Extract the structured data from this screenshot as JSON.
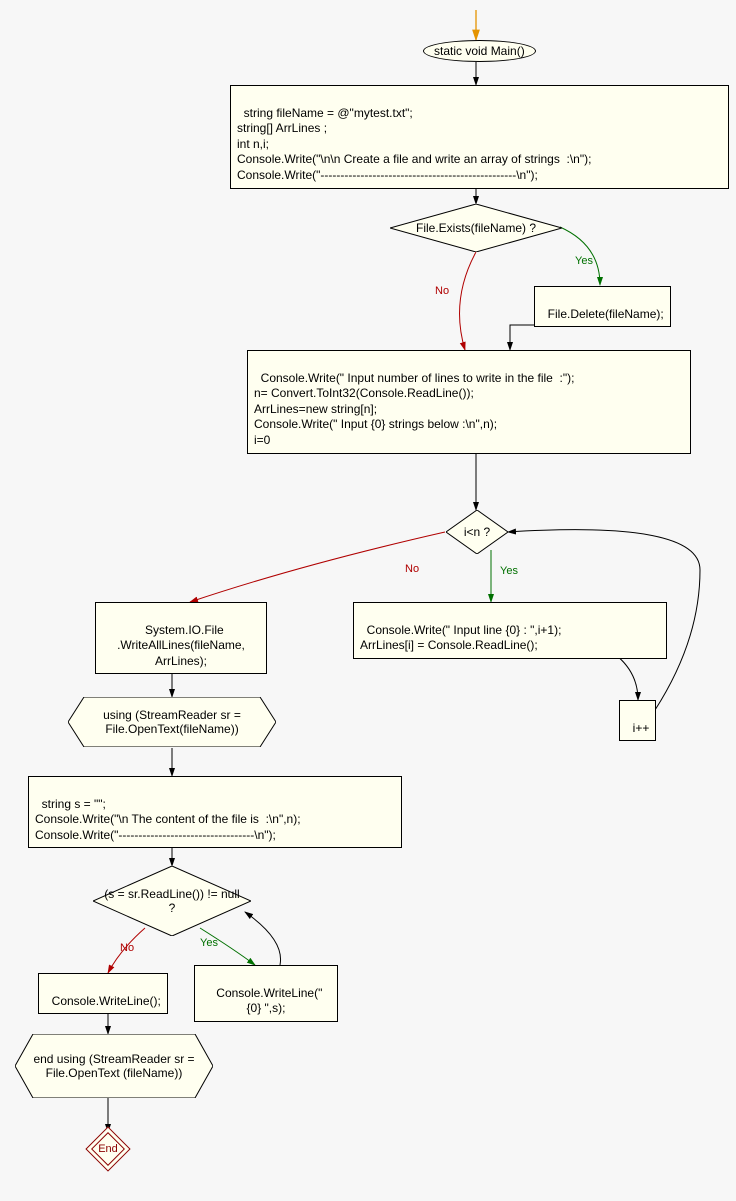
{
  "chart_data": {
    "type": "flowchart",
    "title": "",
    "nodes": [
      {
        "id": "start",
        "kind": "terminator",
        "label": "static void Main()"
      },
      {
        "id": "init",
        "kind": "process",
        "label": "string fileName = @\"mytest.txt\";\nstring[] ArrLines ;\nint n,i;\nConsole.Write(\"\\n\\n Create a file and write an array of strings  :\\n\");\nConsole.Write(\"-------------------------------------------------\\n\");"
      },
      {
        "id": "dec1",
        "kind": "decision",
        "label": "File.Exists(fileName) ?"
      },
      {
        "id": "del",
        "kind": "process",
        "label": "File.Delete(fileName);"
      },
      {
        "id": "input",
        "kind": "process",
        "label": "Console.Write(\" Input number of lines to write in the file  :\");\nn= Convert.ToInt32(Console.ReadLine());\nArrLines=new string[n];\nConsole.Write(\" Input {0} strings below :\\n\",n);\ni=0"
      },
      {
        "id": "dec2",
        "kind": "decision",
        "label": "i<n ?"
      },
      {
        "id": "write",
        "kind": "process",
        "label": "System.IO.File\n.WriteAllLines(fileName,\nArrLines);"
      },
      {
        "id": "loopIn",
        "kind": "process",
        "label": "Console.Write(\" Input line {0} : \",i+1);\nArrLines[i] = Console.ReadLine();"
      },
      {
        "id": "inc",
        "kind": "process",
        "label": "i++"
      },
      {
        "id": "using",
        "kind": "preparation",
        "label": "using (StreamReader sr =\nFile.OpenText(fileName))"
      },
      {
        "id": "sinit",
        "kind": "process",
        "label": "string s = \"\";\nConsole.Write(\"\\n The content of the file is  :\\n\",n);\nConsole.Write(\"----------------------------------\\n\");"
      },
      {
        "id": "dec3",
        "kind": "decision",
        "label": "(s = sr.ReadLine())\n!= null ?"
      },
      {
        "id": "cw",
        "kind": "process",
        "label": "Console.WriteLine();"
      },
      {
        "id": "cw2",
        "kind": "process",
        "label": "Console.WriteLine(\"\n{0} \",s);"
      },
      {
        "id": "endusing",
        "kind": "preparation",
        "label": "end using (StreamReader\nsr = File.OpenText\n(fileName))"
      },
      {
        "id": "end",
        "kind": "terminator",
        "label": "End"
      }
    ],
    "edges": [
      {
        "from": "entry",
        "to": "start"
      },
      {
        "from": "start",
        "to": "init"
      },
      {
        "from": "init",
        "to": "dec1"
      },
      {
        "from": "dec1",
        "to": "del",
        "label": "Yes"
      },
      {
        "from": "dec1",
        "to": "input",
        "label": "No"
      },
      {
        "from": "del",
        "to": "input"
      },
      {
        "from": "input",
        "to": "dec2"
      },
      {
        "from": "dec2",
        "to": "loopIn",
        "label": "Yes"
      },
      {
        "from": "dec2",
        "to": "write",
        "label": "No"
      },
      {
        "from": "loopIn",
        "to": "inc"
      },
      {
        "from": "inc",
        "to": "dec2"
      },
      {
        "from": "write",
        "to": "using"
      },
      {
        "from": "using",
        "to": "sinit"
      },
      {
        "from": "sinit",
        "to": "dec3"
      },
      {
        "from": "dec3",
        "to": "cw2",
        "label": "Yes"
      },
      {
        "from": "cw2",
        "to": "dec3"
      },
      {
        "from": "dec3",
        "to": "cw",
        "label": "No"
      },
      {
        "from": "cw",
        "to": "endusing"
      },
      {
        "from": "endusing",
        "to": "end"
      }
    ]
  },
  "labels": {
    "yes": "Yes",
    "no": "No"
  }
}
